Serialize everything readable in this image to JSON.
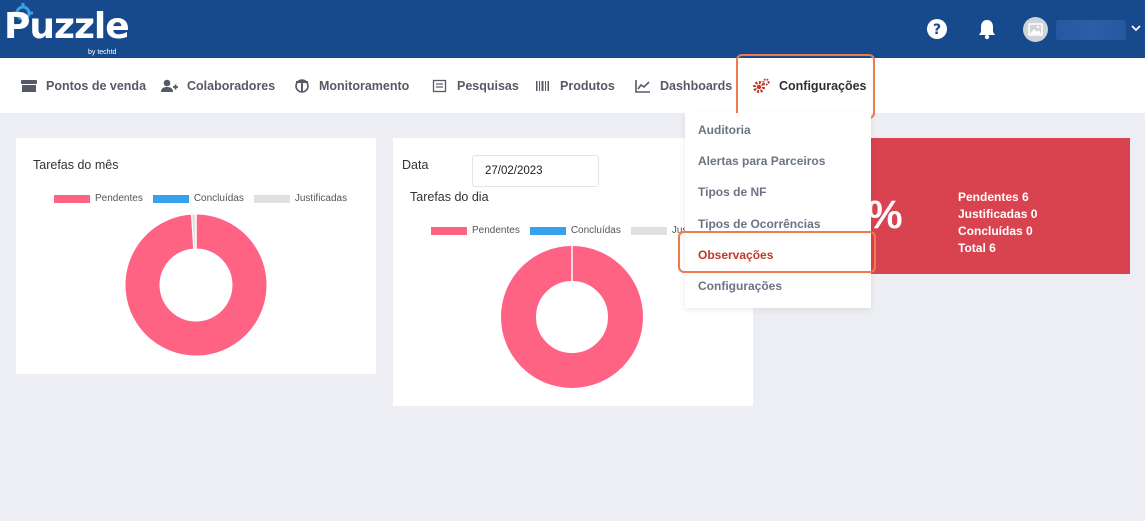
{
  "header": {
    "logo_text": "Puzzle",
    "logo_subtext": "by techtd"
  },
  "nav": {
    "items": [
      {
        "label": "Pontos de venda",
        "icon": "store-icon"
      },
      {
        "label": "Colaboradores",
        "icon": "users-icon"
      },
      {
        "label": "Monitoramento",
        "icon": "monitor-icon"
      },
      {
        "label": "Pesquisas",
        "icon": "survey-icon"
      },
      {
        "label": "Produtos",
        "icon": "barcode-icon"
      },
      {
        "label": "Dashboards",
        "icon": "chart-line-icon"
      },
      {
        "label": "Configurações",
        "icon": "gears-icon"
      }
    ]
  },
  "dropdown": {
    "items": [
      "Auditoria",
      "Alertas para Parceiros",
      "Tipos de NF",
      "Tipos de Ocorrências",
      "Observações",
      "Configurações"
    ],
    "active": "Observações"
  },
  "month_card": {
    "title": "Tarefas do mês",
    "legend": [
      "Pendentes",
      "Concluídas",
      "Justificadas"
    ]
  },
  "day_card": {
    "date_label": "Data",
    "date_value": "27/02/2023",
    "title": "Tarefas do dia",
    "legend": [
      "Pendentes",
      "Concluídas",
      "Justi"
    ]
  },
  "summary_card": {
    "percent_glyph": "%",
    "lines": [
      "Pendentes 6",
      "Justificadas 0",
      "Concluídas 0",
      "Total 6"
    ]
  },
  "colors": {
    "header_bg": "#174a8c",
    "pendentes": "#ff6384",
    "concluidas": "#36a2eb",
    "justificadas": "#e0e0e0",
    "summary_bg": "#d9434f",
    "highlight": "#f07b4a"
  },
  "chart_data": [
    {
      "type": "pie",
      "title": "Tarefas do mês",
      "categories": [
        "Pendentes",
        "Concluídas",
        "Justificadas"
      ],
      "values": [
        99,
        0,
        1
      ]
    },
    {
      "type": "pie",
      "title": "Tarefas do dia",
      "categories": [
        "Pendentes",
        "Concluídas",
        "Justificadas"
      ],
      "values": [
        6,
        0,
        0
      ]
    }
  ]
}
